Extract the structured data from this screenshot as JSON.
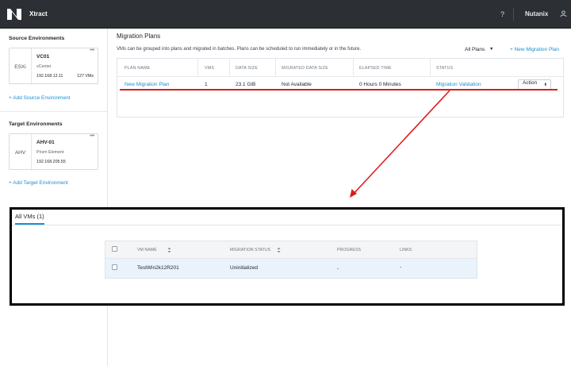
{
  "topbar": {
    "app_name": "Xtract",
    "help": "?",
    "user": "Nutanix"
  },
  "sidebar": {
    "source_title": "Source Environments",
    "source_env": {
      "type": "ESXi",
      "name": "VC01",
      "kind": "vCenter",
      "ip": "192.168.12.11",
      "vms": "127 VMs",
      "more": "•••"
    },
    "add_source": "+ Add Source Environment",
    "target_title": "Target Environments",
    "target_env": {
      "type": "AHV",
      "name": "AHV-01",
      "kind": "Prism Element",
      "ip": "192.168.205.55",
      "more": "•••"
    },
    "add_target": "+ Add Target Environment"
  },
  "main": {
    "title": "Migration Plans",
    "description": "VMs can be grouped into plans and migrated in batches. Plans can be scheduled to run immediately or in the future.",
    "filter": "All Plans",
    "new_plan": "+ New Migration Plan",
    "table": {
      "headers": [
        "PLAN NAME",
        "VMS",
        "DATA SIZE",
        "MIGRATED DATA SIZE",
        "ELAPSED TIME",
        "STATUS"
      ],
      "row": {
        "plan_name": "New Migration Plan",
        "vms": "1",
        "data_size": "23.1 GiB",
        "migrated": "Not Available",
        "elapsed": "0 Hours 0 Minutes",
        "status": "Migration Validation",
        "action": "Action"
      }
    }
  },
  "zoom": {
    "tab": "All VMs (1)",
    "headers": [
      "VM NAME",
      "MIGRATION STATUS",
      "PROGRESS",
      "LINKS"
    ],
    "row": {
      "vm_name": "TestWin2k12R201",
      "status": "Uninitialized",
      "progress": "-",
      "links": "-"
    }
  },
  "colors": {
    "accent": "#1b8fd1",
    "topbar": "#2c2f33",
    "annotation": "#e01b1b"
  }
}
